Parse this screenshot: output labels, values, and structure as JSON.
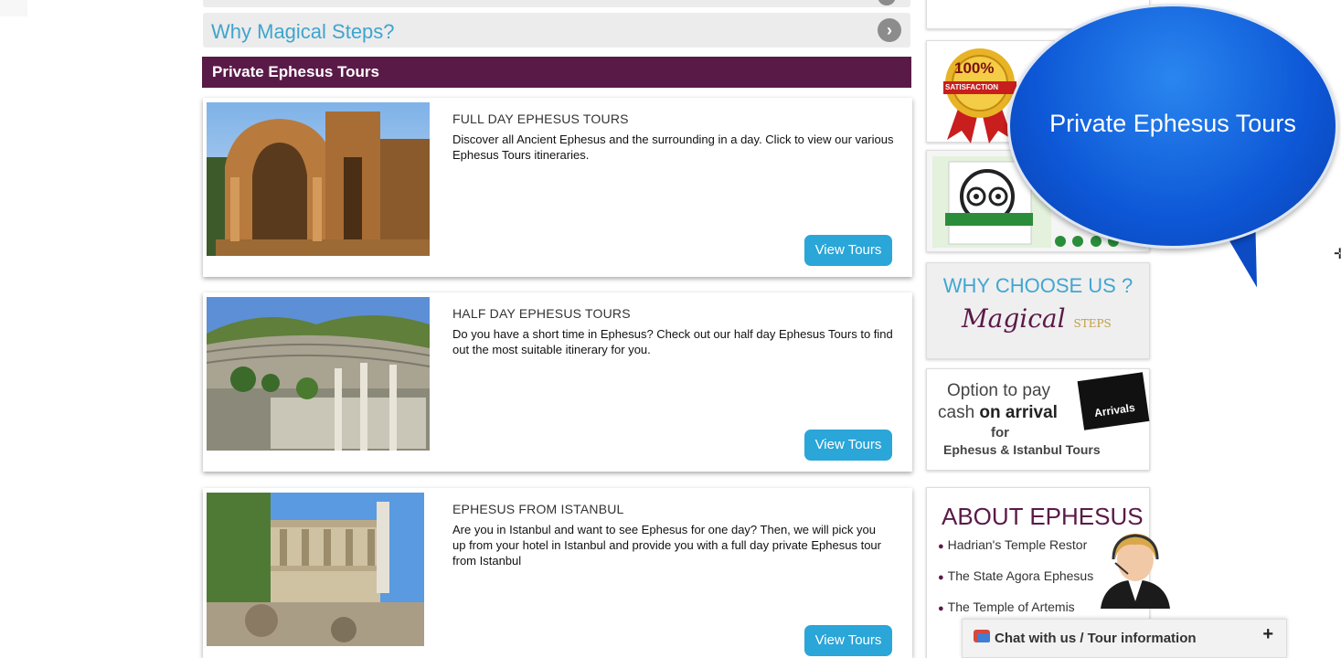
{
  "accordion": {
    "why_label": "Why Magical Steps?"
  },
  "section": {
    "title": "Private Ephesus Tours"
  },
  "tours": [
    {
      "title": "FULL DAY EPHESUS TOURS",
      "description": "Discover all Ancient Ephesus and the surrounding in a day. Click to view our various Ephesus Tours itineraries.",
      "button": "View Tours"
    },
    {
      "title": "HALF DAY EPHESUS TOURS",
      "description": "Do you have a short time in Ephesus? Check out our half day Ephesus Tours to find out the most suitable itinerary for you.",
      "button": "View Tours"
    },
    {
      "title": "EPHESUS FROM ISTANBUL",
      "description": "Are you in Istanbul and want to see Ephesus for one day? Then, we will pick you up from your hotel in Istanbul and provide you with a full day private Ephesus tour from Istanbul",
      "button": "View Tours"
    }
  ],
  "sidebar": {
    "satisfaction_badge": "100%",
    "satisfaction_ribbon": "SATISFACTION",
    "why_choose": "WHY CHOOSE US ?",
    "magical_logo": "Magical",
    "magical_logo_steps": "STEPS",
    "pay_line1": "Option to pay",
    "pay_line2_a": "cash ",
    "pay_line2_b": "on arrival",
    "pay_line3": "for",
    "pay_line4": "Ephesus & Istanbul Tours",
    "arrivals": "Arrivals",
    "about_title": "ABOUT EPHESUS",
    "about_items": [
      "Hadrian's Temple Restor",
      "The State Agora Ephesus",
      "The Temple of Artemis"
    ]
  },
  "bubble": {
    "text": "Private Ephesus Tours"
  },
  "chat": {
    "label": "Chat with us / Tour information",
    "plus": "+"
  },
  "colors": {
    "header_purple": "#5a1a48",
    "button_blue": "#2aa6d8",
    "link_blue": "#3fa4cf",
    "bubble_blue": "#0d57d6"
  }
}
